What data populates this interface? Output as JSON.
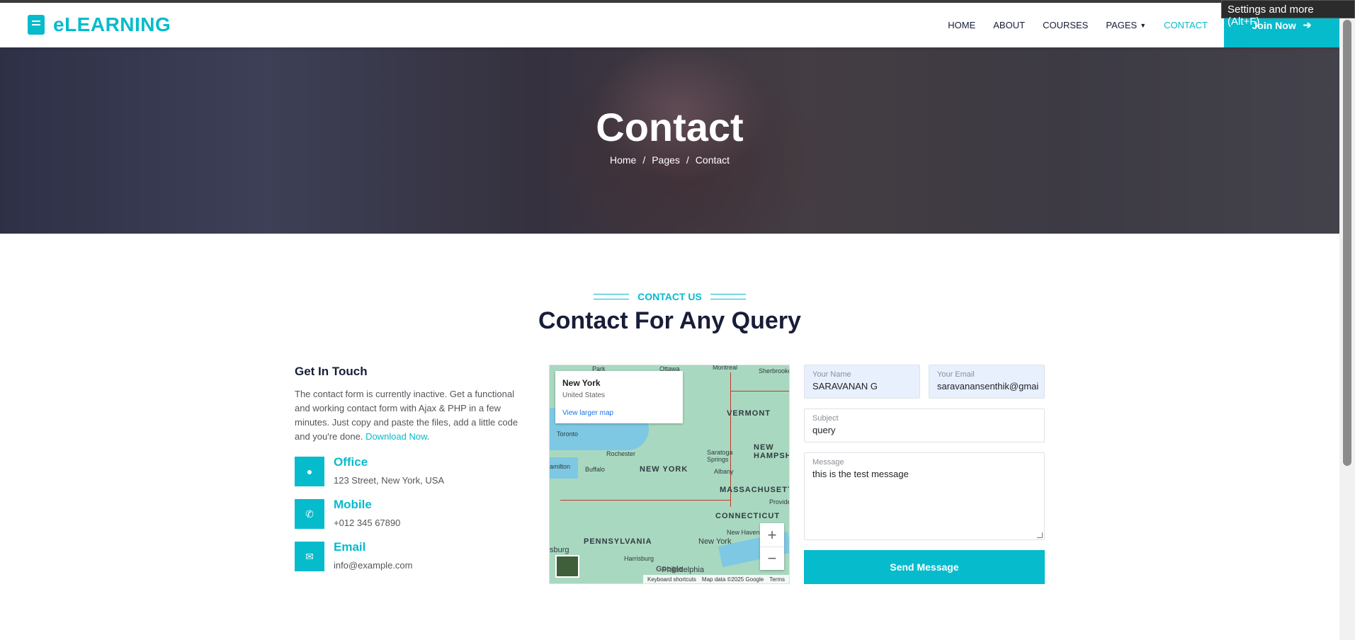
{
  "tooltip": "Settings and more (Alt+F)",
  "brand": {
    "name": "eLEARNING",
    "icon": "book-icon"
  },
  "nav": {
    "links": [
      "HOME",
      "ABOUT",
      "COURSES",
      "PAGES",
      "CONTACT"
    ],
    "active": "CONTACT",
    "join_label": "Join Now",
    "join_icon": "arrow-right-icon"
  },
  "hero": {
    "title": "Contact",
    "breadcrumb": [
      "Home",
      "Pages",
      "Contact"
    ]
  },
  "section": {
    "subtitle": "Contact Us",
    "title": "Contact For Any Query"
  },
  "info": {
    "heading": "Get In Touch",
    "text": "The contact form is currently inactive. Get a functional and working contact form with Ajax & PHP in a few minutes. Just copy and paste the files, add a little code and you're done. ",
    "link": "Download Now",
    "period": ".",
    "items": [
      {
        "title": "Office",
        "value": "123 Street, New York, USA",
        "icon": "map-marker-icon"
      },
      {
        "title": "Mobile",
        "value": "+012 345 67890",
        "icon": "phone-icon"
      },
      {
        "title": "Email",
        "value": "info@example.com",
        "icon": "envelope-icon"
      }
    ]
  },
  "map": {
    "card_title": "New York",
    "card_sub": "United States",
    "card_link": "View larger map",
    "labels": [
      "NEW YORK",
      "VERMONT",
      "MASSACHUSETT",
      "CONNECTICUT",
      "PENNSYLVANIA",
      "NEW HAMPSH"
    ],
    "cities": [
      "Park",
      "Ottawa",
      "Montreal",
      "Sherbrooke",
      "Toronto",
      "amilton",
      "Rochester",
      "Buffalo",
      "Saratoga Springs",
      "Albany",
      "Provide",
      "New Haven",
      "New York",
      "Harrisburg",
      "Philadelphia",
      "sburg"
    ],
    "footer": [
      "Keyboard shortcuts",
      "Map data ©2025 Google",
      "Terms"
    ],
    "google": "Google"
  },
  "form": {
    "name_label": "Your Name",
    "name_value": "SARAVANAN G",
    "email_label": "Your Email",
    "email_value": "saravanansenthik@gmail.com",
    "subject_label": "Subject",
    "subject_value": "query",
    "message_label": "Message",
    "message_value": "this is the test message",
    "send_label": "Send Message"
  },
  "colors": {
    "primary": "#06bbcc",
    "dark": "#181d38"
  }
}
